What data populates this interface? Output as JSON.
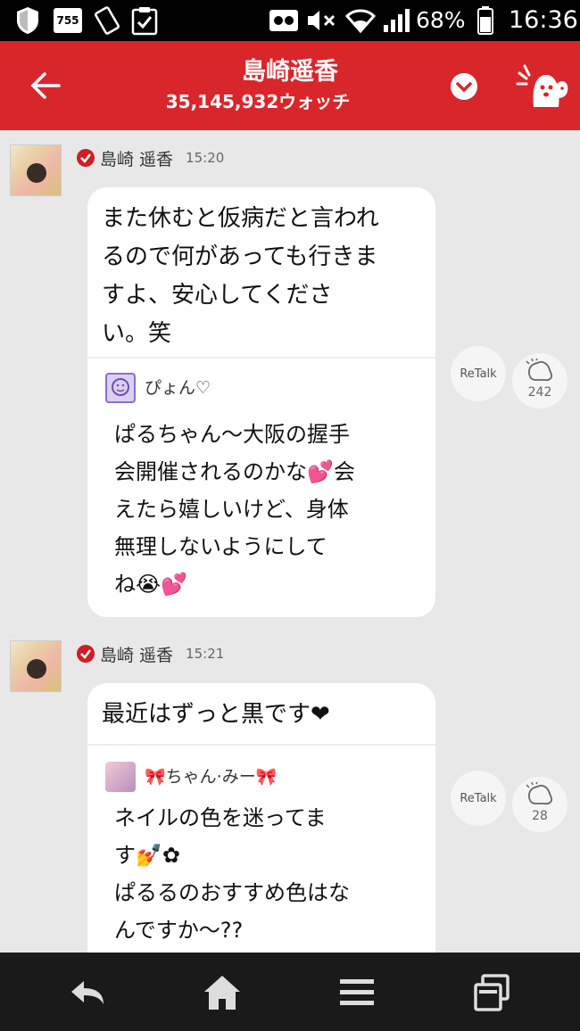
{
  "status_bar": {
    "notification_badge": "755",
    "battery_percent": "68%",
    "time": "16:36"
  },
  "header": {
    "title": "島崎遥香",
    "subtitle": "35,145,932ウォッチ"
  },
  "messages": [
    {
      "sender": "島崎 遥香",
      "time": "15:20",
      "text": "また休むと仮病だと言われ\nるので何があっても行きま\nすよ、安心してくださ\nい。笑",
      "reply": {
        "name": "ぴょん♡",
        "text": "ぱるちゃん〜大阪の握手\n会開催されるのかな💕会\nえたら嬉しいけど、身体\n無理しないようにして\nね😭💕"
      },
      "retalk_label": "ReTalk",
      "clap_count": "242"
    },
    {
      "sender": "島崎 遥香",
      "time": "15:21",
      "text": "最近はずっと黒です❤",
      "reply": {
        "name": "🎀ちゃん·みー🎀",
        "text": "ネイルの色を迷ってま\nす💅✿\nぱるるのおすすめ色はな\nんですか〜??"
      },
      "retalk_label": "ReTalk",
      "clap_count": "28"
    }
  ],
  "colors": {
    "header_red": "#d9262b",
    "verified_red": "#cc1f26",
    "background": "#e8e8e8"
  }
}
